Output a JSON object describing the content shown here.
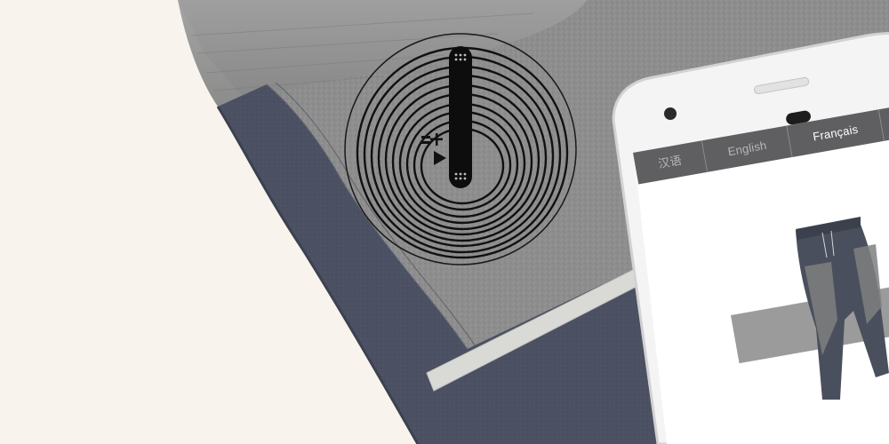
{
  "phone": {
    "language_tabs": [
      {
        "label": "汉语",
        "state": "inactive"
      },
      {
        "label": "English",
        "state": "inactive"
      },
      {
        "label": "Français",
        "state": "active"
      }
    ]
  },
  "nfc_tag": {
    "icon": "nfc-antenna-icon",
    "glyphs": [
      "=",
      "+",
      "▶"
    ]
  },
  "colors": {
    "background": "#f8f3ec",
    "heather_gray": "#8f8f8f",
    "navy_fabric": "#4a5060",
    "phone_body": "#f2f2f2",
    "lang_bar": "#5f5f62"
  }
}
